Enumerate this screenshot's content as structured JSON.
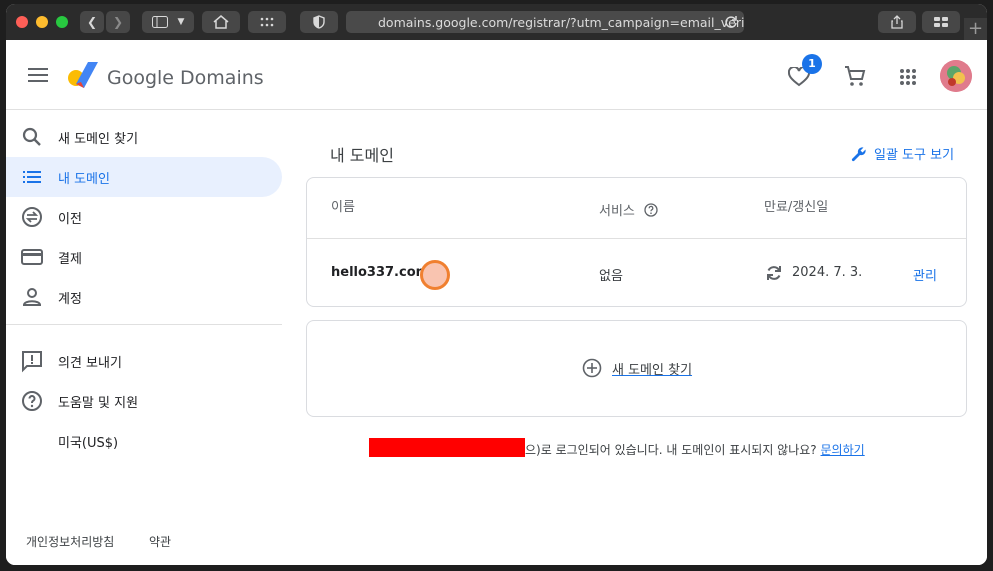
{
  "browser": {
    "url": "domains.google.com/registrar/?utm_campaign=email_verif",
    "plus": "+"
  },
  "header": {
    "brand": "Google Domains",
    "favorites_count": "1"
  },
  "sidebar": {
    "items": [
      {
        "label": "새 도메인 찾기"
      },
      {
        "label": "내 도메인"
      },
      {
        "label": "이전"
      },
      {
        "label": "결제"
      },
      {
        "label": "계정"
      },
      {
        "label": "의견 보내기"
      },
      {
        "label": "도움말 및 지원"
      },
      {
        "label": "미국(US$)"
      }
    ],
    "footer": {
      "privacy": "개인정보처리방침",
      "terms": "약관"
    }
  },
  "main": {
    "title": "내 도메인",
    "bulk_tools": "일괄 도구 보기",
    "table": {
      "headers": {
        "name": "이름",
        "services": "서비스",
        "expiry": "만료/갱신일"
      },
      "rows": [
        {
          "domain": "hello337.com",
          "services": "없음",
          "date": "2024. 7. 3.",
          "manage": "관리"
        }
      ]
    },
    "add_domain": "새 도메인 찾기",
    "login_notice": "으)로 로그인되어 있습니다. 내 도메인이 표시되지 않나요?",
    "contact_link": "문의하기"
  },
  "colors": {
    "accent": "#1a73e8",
    "selected_bg": "#e8f0fe",
    "redaction": "#ff0000",
    "cursor": "#f08030"
  }
}
